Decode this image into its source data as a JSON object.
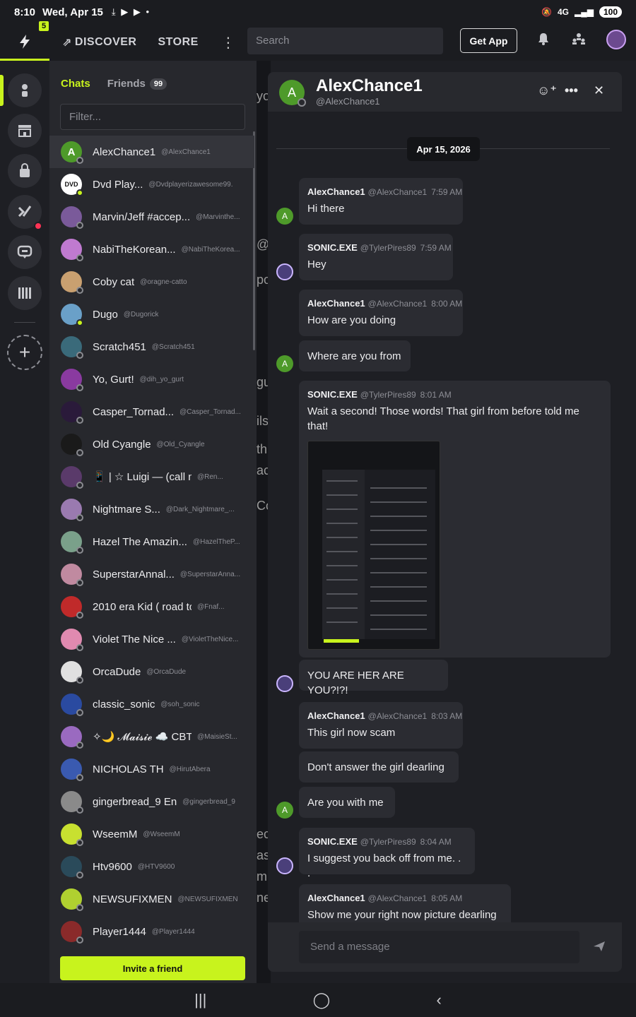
{
  "status_bar": {
    "time": "8:10",
    "date": "Wed, Apr 15",
    "icons": "⤓ ▶ ▶ •",
    "signal": "4G",
    "battery": "100"
  },
  "topbar": {
    "badge": "5",
    "discover": "DISCOVER",
    "store": "STORE",
    "search_placeholder": "Search",
    "get_app": "Get App"
  },
  "rail": {
    "icons": [
      "user-icon",
      "store-icon",
      "shop-bag-icon",
      "quests-icon",
      "chat-bubble-icon",
      "library-icon",
      "add-icon"
    ]
  },
  "chatlist": {
    "tab_chats": "Chats",
    "tab_friends": "Friends",
    "friends_count": "99",
    "filter_placeholder": "Filter...",
    "invite_label": "Invite a friend",
    "friends": [
      {
        "name": "AlexChance1",
        "user": "@AlexChance1",
        "color": "#4e9a2a",
        "initial": "A",
        "online": false
      },
      {
        "name": "Dvd Play...",
        "user": "@Dvdplayerizawesome99...",
        "color": "#ffffff",
        "initial": "DVD",
        "online": true
      },
      {
        "name": "Marvin/Jeff #accep...",
        "user": "@Marvinthe...",
        "color": "#7a5a9a",
        "initial": "",
        "online": false
      },
      {
        "name": "NabiTheKorean...",
        "user": "@NabiTheKorea...",
        "color": "#c07ad0",
        "initial": "",
        "online": false
      },
      {
        "name": "Coby cat",
        "user": "@oragne-catto",
        "color": "#c9a070",
        "initial": "",
        "online": false
      },
      {
        "name": "Dugo",
        "user": "@Dugorick",
        "color": "#6aa0c8",
        "initial": "",
        "online": true
      },
      {
        "name": "Scratch451",
        "user": "@Scratch451",
        "color": "#3a6a7a",
        "initial": "",
        "online": false
      },
      {
        "name": "Yo, Gurt!",
        "user": "@dih_yo_gurt",
        "color": "#8a3aa0",
        "initial": "",
        "online": false
      },
      {
        "name": "Casper_Tornad...",
        "user": "@Casper_Tornad...",
        "color": "#2a1a3a",
        "initial": "",
        "online": false
      },
      {
        "name": "Old Cyangle",
        "user": "@Old_Cyangle",
        "color": "#1a1a1a",
        "initial": "",
        "online": false
      },
      {
        "name": "📱 | ☆ Luigi — (call me ...",
        "user": "@Ren...",
        "color": "#5a3a6a",
        "initial": "",
        "online": false
      },
      {
        "name": "Nightmare S...",
        "user": "@Dark_Nightmare_...",
        "color": "#9a7ab0",
        "initial": "",
        "online": false
      },
      {
        "name": "Hazel The Amazin...",
        "user": "@HazelTheP...",
        "color": "#7aa08a",
        "initial": "",
        "online": false
      },
      {
        "name": "SuperstarAnnal...",
        "user": "@SuperstarAnna...",
        "color": "#c08aa0",
        "initial": "",
        "online": false
      },
      {
        "name": "2010 era Kid ( road to ...",
        "user": "@Fnaf...",
        "color": "#c02a2a",
        "initial": "",
        "online": false
      },
      {
        "name": "Violet The Nice ...",
        "user": "@VioletTheNice...",
        "color": "#e08ab0",
        "initial": "",
        "online": false
      },
      {
        "name": "OrcaDude",
        "user": "@OrcaDude",
        "color": "#e0e0e0",
        "initial": "",
        "online": false
      },
      {
        "name": "classic_sonic",
        "user": "@soh_sonic",
        "color": "#2a4aa0",
        "initial": "",
        "online": false
      },
      {
        "name": "✧🌙 𝓜𝓪𝓲𝓼𝓲𝓮 ☁️ CBT...",
        "user": "@MaisieSt...",
        "color": "#9a6ac0",
        "initial": "",
        "online": false
      },
      {
        "name": "NICHOLAS TH",
        "user": "@HirutAbera",
        "color": "#3a5ab0",
        "initial": "",
        "online": false
      },
      {
        "name": "gingerbread_9 En",
        "user": "@gingerbread_9",
        "color": "#8a8a8a",
        "initial": "",
        "online": false
      },
      {
        "name": "WseemM",
        "user": "@WseemM",
        "color": "#c8e030",
        "initial": "",
        "online": false
      },
      {
        "name": "Htv9600",
        "user": "@HTV9600",
        "color": "#2a4a5a",
        "initial": "",
        "online": false
      },
      {
        "name": "NEWSUFIXMEN",
        "user": "@NEWSUFIXMEN",
        "color": "#b0d030",
        "initial": "",
        "online": false
      },
      {
        "name": "Player1444",
        "user": "@Player1444",
        "color": "#8a2a2a",
        "initial": "",
        "online": false
      }
    ]
  },
  "background_fragments": [
    "you",
    "@R",
    "po",
    "gu",
    "ils",
    "th",
    "ac",
    "Co",
    "ec",
    "asl",
    "mb",
    "ne"
  ],
  "dm": {
    "avatar_initial": "A",
    "title": "AlexChance1",
    "subtitle": "@AlexChance1",
    "date": "Apr 15, 2026",
    "composer_placeholder": "Send a message",
    "messages": [
      {
        "author": "AlexChance1",
        "handle": "@AlexChance1",
        "time": "7:59 AM",
        "text": "Hi there"
      },
      {
        "author": "SONIC.EXE",
        "handle": "@TylerPires89",
        "time": "7:59 AM",
        "text": "Hey"
      },
      {
        "author": "AlexChance1",
        "handle": "@AlexChance1",
        "time": "8:00 AM",
        "text": "How are you doing"
      },
      {
        "author": "",
        "handle": "",
        "time": "",
        "text": "Where are you from"
      },
      {
        "author": "SONIC.EXE",
        "handle": "@TylerPires89",
        "time": "8:01 AM",
        "text": "Wait a second! Those words! That girl from before told me that!"
      },
      {
        "author": "",
        "handle": "",
        "time": "",
        "text": "YOU ARE HER ARE YOU?!?!"
      },
      {
        "author": "AlexChance1",
        "handle": "@AlexChance1",
        "time": "8:03 AM",
        "text": "This girl now scam"
      },
      {
        "author": "",
        "handle": "",
        "time": "",
        "text": "Don't answer the girl dearling"
      },
      {
        "author": "",
        "handle": "",
        "time": "",
        "text": "Are you with me"
      },
      {
        "author": "SONIC.EXE",
        "handle": "@TylerPires89",
        "time": "8:04 AM",
        "text": "I suggest you back off from me. . ."
      },
      {
        "author": "AlexChance1",
        "handle": "@AlexChance1",
        "time": "8:05 AM",
        "text": "Show me your right now picture dearling"
      }
    ]
  },
  "navbar": {
    "recents": "|||",
    "home": "◯",
    "back": "‹"
  }
}
